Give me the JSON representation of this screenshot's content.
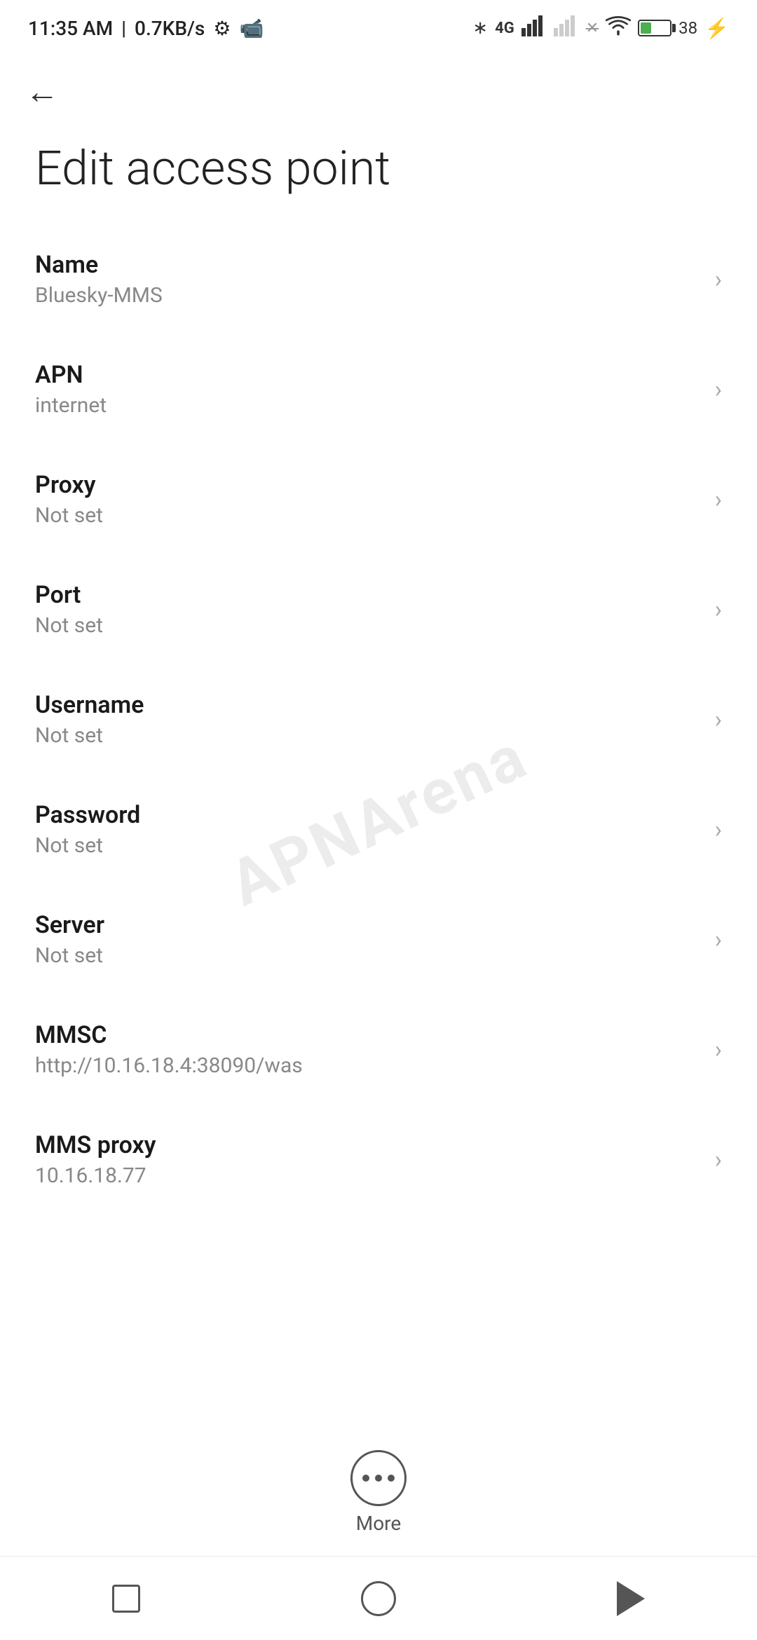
{
  "statusBar": {
    "time": "11:35 AM",
    "speed": "0.7KB/s"
  },
  "toolbar": {
    "backLabel": "←"
  },
  "page": {
    "title": "Edit access point"
  },
  "settings": [
    {
      "id": "name",
      "label": "Name",
      "value": "Bluesky-MMS"
    },
    {
      "id": "apn",
      "label": "APN",
      "value": "internet"
    },
    {
      "id": "proxy",
      "label": "Proxy",
      "value": "Not set"
    },
    {
      "id": "port",
      "label": "Port",
      "value": "Not set"
    },
    {
      "id": "username",
      "label": "Username",
      "value": "Not set"
    },
    {
      "id": "password",
      "label": "Password",
      "value": "Not set"
    },
    {
      "id": "server",
      "label": "Server",
      "value": "Not set"
    },
    {
      "id": "mmsc",
      "label": "MMSC",
      "value": "http://10.16.18.4:38090/was"
    },
    {
      "id": "mms-proxy",
      "label": "MMS proxy",
      "value": "10.16.18.77"
    }
  ],
  "bottomAction": {
    "label": "More"
  },
  "watermark": {
    "text": "APNArena"
  }
}
